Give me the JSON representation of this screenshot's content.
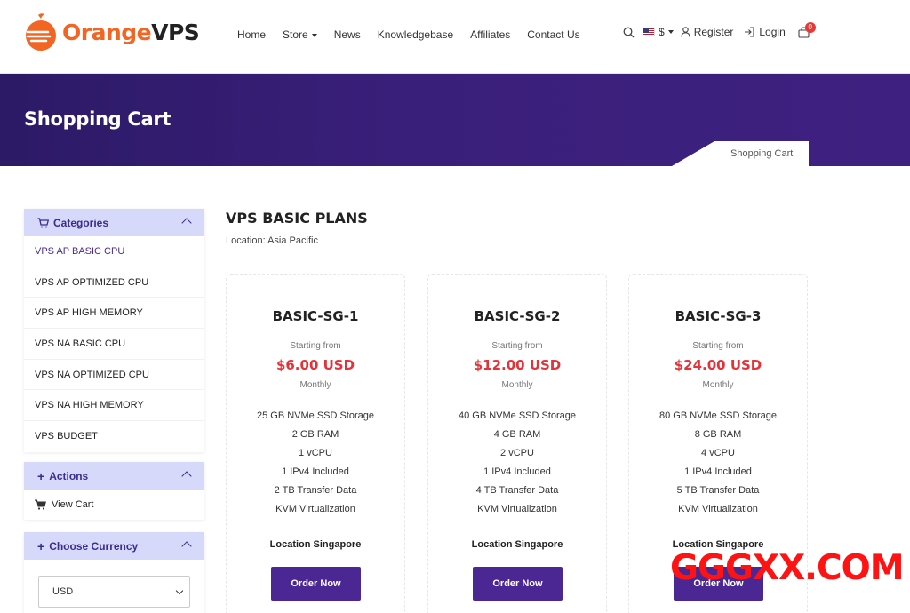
{
  "header": {
    "logo": {
      "part1": "Orange",
      "part2": "VPS"
    },
    "nav": [
      "Home",
      "Store",
      "News",
      "Knowledgebase",
      "Affiliates",
      "Contact Us"
    ],
    "currency_symbol": "$",
    "register": "Register",
    "login": "Login",
    "cart_count": "0"
  },
  "banner": {
    "title": "Shopping Cart",
    "breadcrumb": "Shopping Cart"
  },
  "sidebar": {
    "categories_title": "Categories",
    "categories": [
      "VPS AP BASIC CPU",
      "VPS AP OPTIMIZED CPU",
      "VPS AP HIGH MEMORY",
      "VPS NA BASIC CPU",
      "VPS NA OPTIMIZED CPU",
      "VPS NA HIGH MEMORY",
      "VPS BUDGET"
    ],
    "actions_title": "Actions",
    "view_cart": "View Cart",
    "currency_title": "Choose Currency",
    "currency_value": "USD"
  },
  "main": {
    "title": "VPS BASIC PLANS",
    "location": "Location: Asia Pacific",
    "plans": [
      {
        "name": "BASIC-SG-1",
        "starting": "Starting from",
        "price": "$6.00 USD",
        "cycle": "Monthly",
        "features": [
          "25 GB NVMe SSD Storage",
          "2 GB RAM",
          "1 vCPU",
          "1 IPv4 Included",
          "2 TB Transfer Data",
          "KVM Virtualization"
        ],
        "location": "Location Singapore",
        "button": "Order Now"
      },
      {
        "name": "BASIC-SG-2",
        "starting": "Starting from",
        "price": "$12.00 USD",
        "cycle": "Monthly",
        "features": [
          "40 GB NVMe SSD Storage",
          "4 GB RAM",
          "2 vCPU",
          "1 IPv4 Included",
          "4 TB Transfer Data",
          "KVM Virtualization"
        ],
        "location": "Location Singapore",
        "button": "Order Now"
      },
      {
        "name": "BASIC-SG-3",
        "starting": "Starting from",
        "price": "$24.00 USD",
        "cycle": "Monthly",
        "features": [
          "80 GB NVMe SSD Storage",
          "8 GB RAM",
          "4 vCPU",
          "1 IPv4 Included",
          "5 TB Transfer Data",
          "KVM Virtualization"
        ],
        "location": "Location Singapore",
        "button": "Order Now"
      }
    ]
  },
  "watermark": "GGGXX.COM",
  "colors": {
    "brand_orange": "#f26522",
    "banner_purple": "#3a1f7a",
    "button_purple": "#4b2794",
    "price_red": "#e53238",
    "panel_head": "#d6d9fa"
  }
}
